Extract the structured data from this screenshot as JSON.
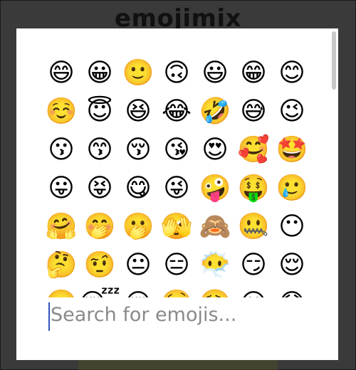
{
  "app": {
    "title": "emojimix"
  },
  "picker": {
    "search": {
      "placeholder": "Search for emojis..."
    },
    "emojis": [
      "😄",
      "😀",
      "🙂",
      "🙃",
      "😃",
      "😁",
      "😊",
      "☺️",
      "😇",
      "😆",
      "😂",
      "🤣",
      "😅",
      "😉",
      "😗",
      "😙",
      "😚",
      "😘",
      "😍",
      "🥰",
      "🤩",
      "😛",
      "😝",
      "😋",
      "😜",
      "🤪",
      "🤑",
      "🥲",
      "🤗",
      "🤭",
      "🫢",
      "🫣",
      "🙈",
      "🤐",
      "😶",
      "🤔",
      "🤨",
      "😐",
      "😑",
      "😶‍🌫️",
      "😏",
      "😌",
      "😬",
      "😴",
      "😪",
      "🤤",
      "😮‍💨",
      "😮",
      "😯"
    ]
  }
}
